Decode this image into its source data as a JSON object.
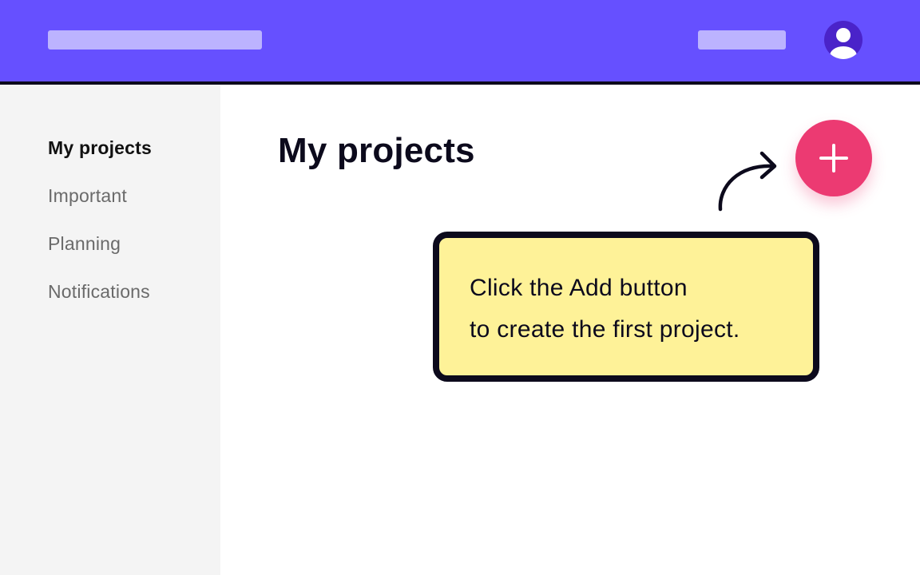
{
  "colors": {
    "header_bg": "#6650ff",
    "header_placeholder": "#bcb3ff",
    "avatar_bg": "#4a23c9",
    "sidebar_bg": "#f4f4f4",
    "fab_bg": "#ec3a72",
    "tooltip_bg": "#fef298",
    "ink": "#0c0a1c"
  },
  "header": {
    "logo_icon": "logo-placeholder",
    "nav_icon": "nav-placeholder",
    "avatar_icon": "user-avatar-icon"
  },
  "sidebar": {
    "items": [
      {
        "label": "My projects",
        "active": true
      },
      {
        "label": "Important",
        "active": false
      },
      {
        "label": "Planning",
        "active": false
      },
      {
        "label": "Notifications",
        "active": false
      }
    ]
  },
  "main": {
    "title": "My projects",
    "add_button_icon": "plus-icon",
    "hint_arrow_icon": "curved-arrow-icon",
    "tooltip": {
      "line1": "Click the Add button",
      "line2": "to create the first project."
    }
  }
}
